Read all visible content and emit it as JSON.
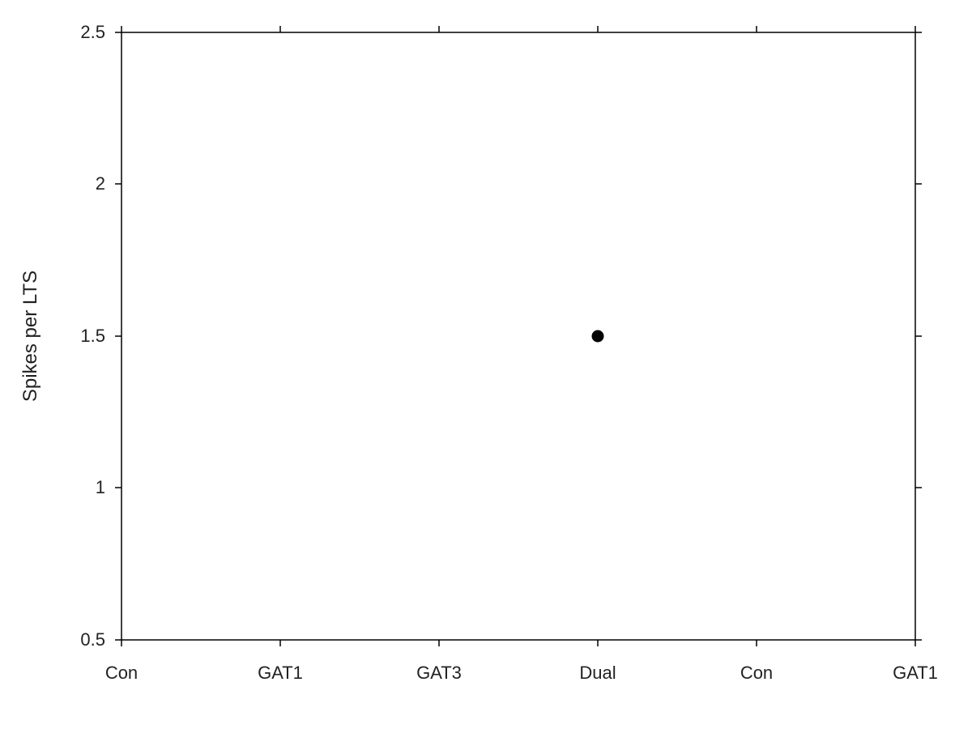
{
  "chart": {
    "title": "",
    "y_axis": {
      "label": "Spikes per LTS",
      "min": 0.5,
      "max": 2.5,
      "ticks": [
        0.5,
        1.0,
        1.5,
        2.0,
        2.5
      ]
    },
    "x_axis": {
      "labels": [
        "Con",
        "GAT1",
        "GAT3",
        "Dual",
        "Con",
        "GAT1"
      ]
    },
    "data_points": [
      {
        "x_index": 3,
        "y_value": 1.5
      }
    ],
    "colors": {
      "axis": "#000",
      "grid": "#ccc",
      "point": "#000",
      "background": "#fff"
    }
  }
}
